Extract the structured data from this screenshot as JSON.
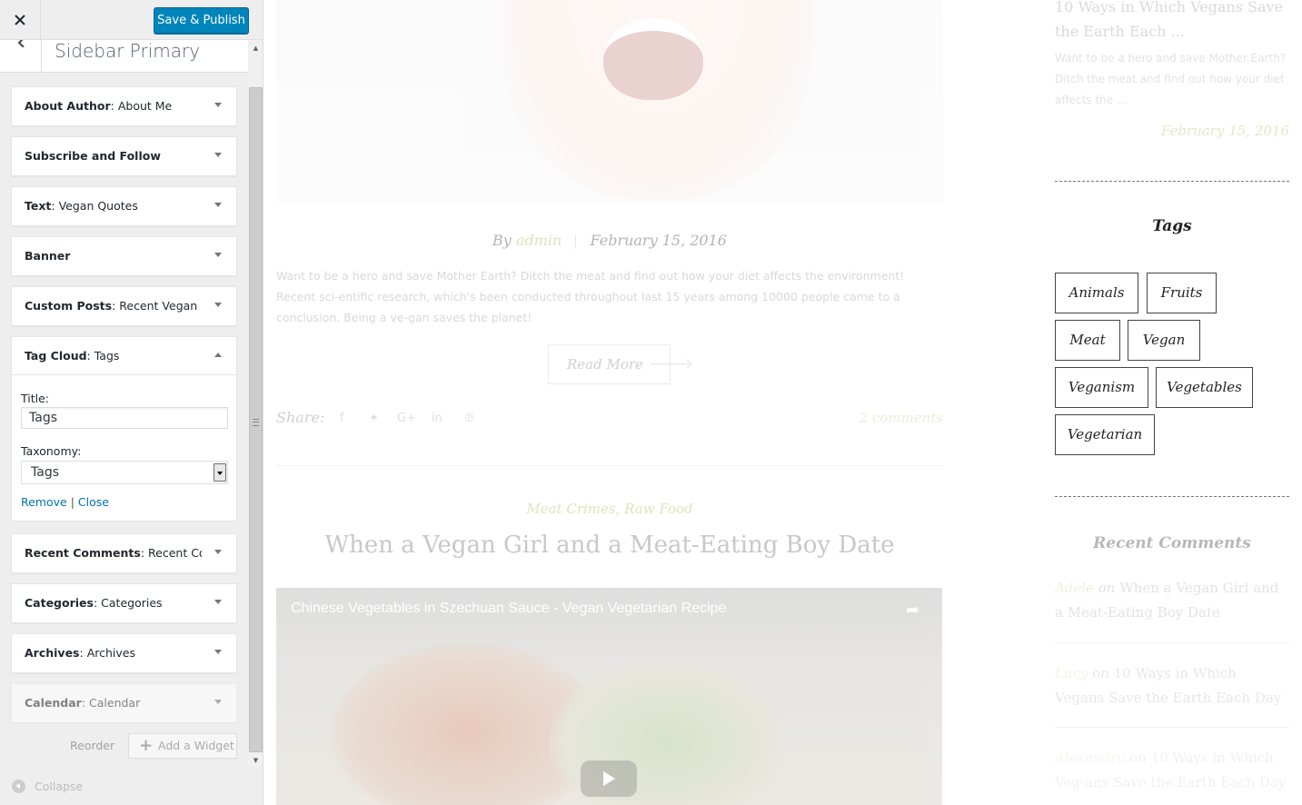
{
  "customizer": {
    "save_label": "Save & Publish",
    "section_title": "Sidebar Primary",
    "widgets": [
      {
        "type": "About Author",
        "title": "About Me"
      },
      {
        "type": "Subscribe and Follow",
        "title": ""
      },
      {
        "type": "Text",
        "title": "Vegan Quotes"
      },
      {
        "type": "Banner",
        "title": ""
      },
      {
        "type": "Custom Posts",
        "title": "Recent Vegan ..."
      },
      {
        "type": "Tag Cloud",
        "title": "Tags"
      },
      {
        "type": "Recent Comments",
        "title": "Recent Co..."
      },
      {
        "type": "Categories",
        "title": "Categories"
      },
      {
        "type": "Archives",
        "title": "Archives"
      },
      {
        "type": "Calendar",
        "title": "Calendar"
      }
    ],
    "tag_cloud_form": {
      "title_label": "Title:",
      "title_value": "Tags",
      "taxonomy_label": "Taxonomy:",
      "taxonomy_value": "Tags",
      "remove_label": "Remove",
      "separator": "|",
      "close_label": "Close"
    },
    "reorder_label": "Reorder",
    "add_widget_label": "Add a Widget",
    "collapse_label": "Collapse"
  },
  "preview": {
    "post_meta": {
      "by": "By",
      "author": "admin",
      "date": "February 15, 2016"
    },
    "excerpt": "Want to be a hero and save Mother Earth? Ditch the meat and find out how your diet affects the environment! Recent sci-entific research, which's been conducted throughout last 15 years among 10000 people came to a conclusion. Being a ve-gan saves the planet!",
    "read_more": "Read More",
    "share_label": "Share:",
    "share_icons": [
      "facebook-icon",
      "twitter-icon",
      "google-plus-icon",
      "linkedin-icon",
      "pinterest-icon"
    ],
    "comments_link": "2 comments",
    "post2": {
      "categories": "Meat Crimes, Raw Food",
      "title": "When a Vegan Girl and a Meat-Eating Boy Date",
      "video_title": "Chinese Vegetables in Szechuan Sauce - Vegan Vegetarian Recipe"
    },
    "right_col": {
      "post_title": "10 Ways in Which Vegans Save the Earth Each ...",
      "post_excerpt": "Want to be a hero and save Mother Earth? Ditch the meat and find out how your diet affects the ...",
      "post_date": "February 15, 2016",
      "tags_heading": "Tags",
      "tags": [
        "Animals",
        "Fruits",
        "Meat",
        "Vegan",
        "Veganism",
        "Vegetables",
        "Vegetarian"
      ],
      "recent_comments_heading": "Recent Comments",
      "recent_comments": [
        {
          "who": "Adele",
          "on": "on",
          "post": "When a Vegan Girl and a Meat-Eating Boy Date"
        },
        {
          "who": "Lucy",
          "on": "on",
          "post": "10 Ways in Which Vegans Save the Earth Each Day"
        },
        {
          "who": "Alexandra",
          "on": "on",
          "post": "10 Ways in Which Veg-ans Save the Earth Each Day"
        }
      ]
    }
  }
}
